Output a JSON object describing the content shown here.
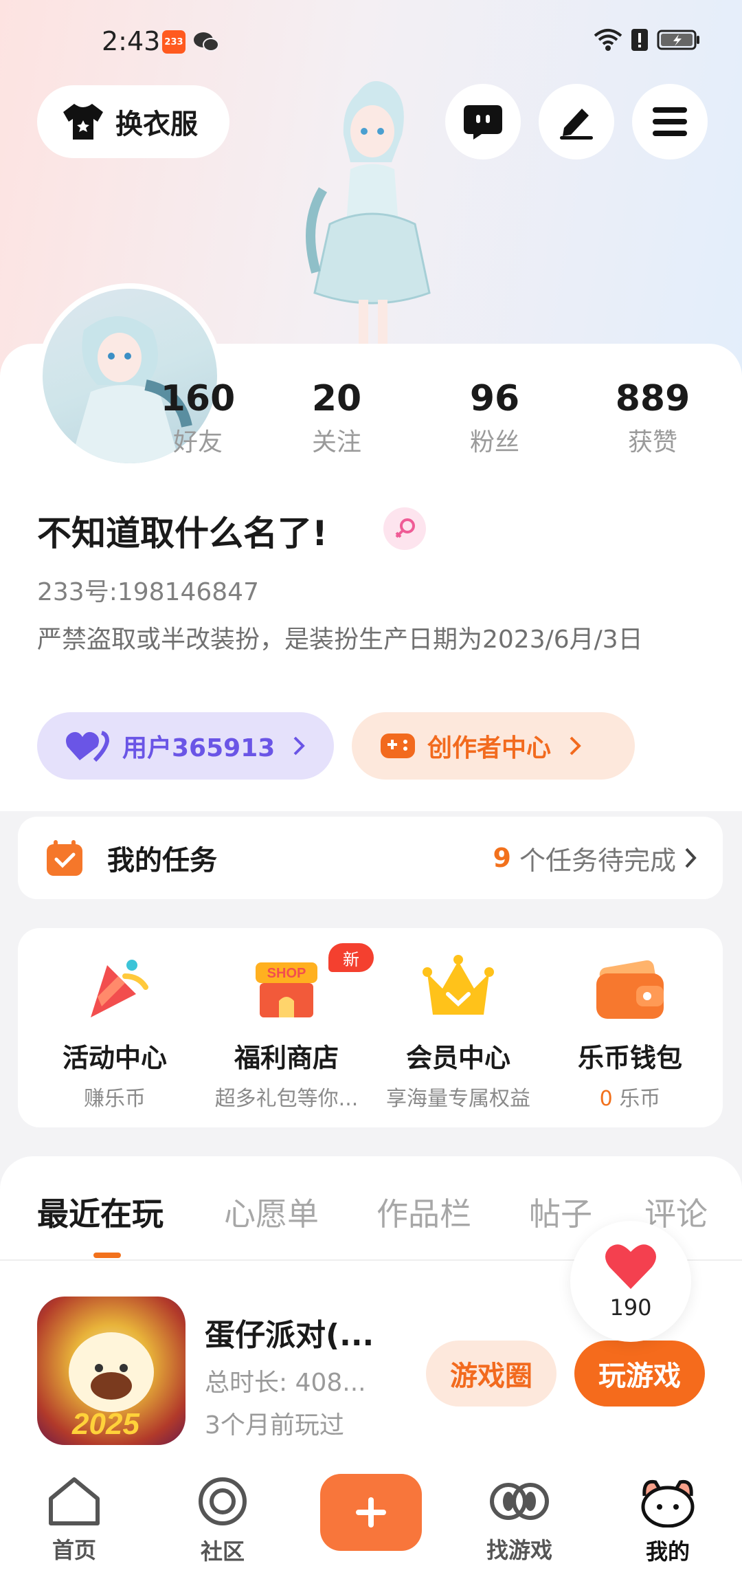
{
  "status_bar": {
    "time": "2:43",
    "app_badge": "233"
  },
  "top_bar": {
    "outfit_label": "换衣服"
  },
  "profile": {
    "stats": [
      {
        "value": "160",
        "label": "好友"
      },
      {
        "value": "20",
        "label": "关注"
      },
      {
        "value": "96",
        "label": "粉丝"
      },
      {
        "value": "889",
        "label": "获赞"
      }
    ],
    "username": "不知道取什么名了!",
    "uid": "233号:198146847",
    "bio": "严禁盗取或半改装扮，是装扮生产日期为2023/6月/3日",
    "user_pill": "用户365913",
    "creator_pill": "创作者中心"
  },
  "tasks": {
    "title": "我的任务",
    "count": "9",
    "suffix": "个任务待完成"
  },
  "shortcuts": [
    {
      "label": "活动中心",
      "sub": "赚乐币"
    },
    {
      "label": "福利商店",
      "sub": "超多礼包等你...",
      "badge": "新",
      "shop_text": "SHOP"
    },
    {
      "label": "会员中心",
      "sub": "享海量专属权益"
    },
    {
      "label": "乐币钱包",
      "sub_count": "0",
      "sub": "乐币"
    }
  ],
  "content_tabs": [
    "最近在玩",
    "心愿单",
    "作品栏",
    "帖子",
    "评论"
  ],
  "recent_game": {
    "title": "蛋仔派对(...",
    "duration": "总时长: 408...",
    "last_played": "3个月前玩过",
    "icon_text": "2025",
    "circle_button": "游戏圈",
    "play_button": "玩游戏"
  },
  "like_float": {
    "count": "190"
  },
  "bottom_nav": [
    {
      "label": "首页"
    },
    {
      "label": "社区"
    },
    {
      "label": "找游戏"
    },
    {
      "label": "我的"
    }
  ],
  "colors": {
    "accent": "#f56b1c",
    "purple": "#6a55e6",
    "badge_red": "#f4402f"
  }
}
